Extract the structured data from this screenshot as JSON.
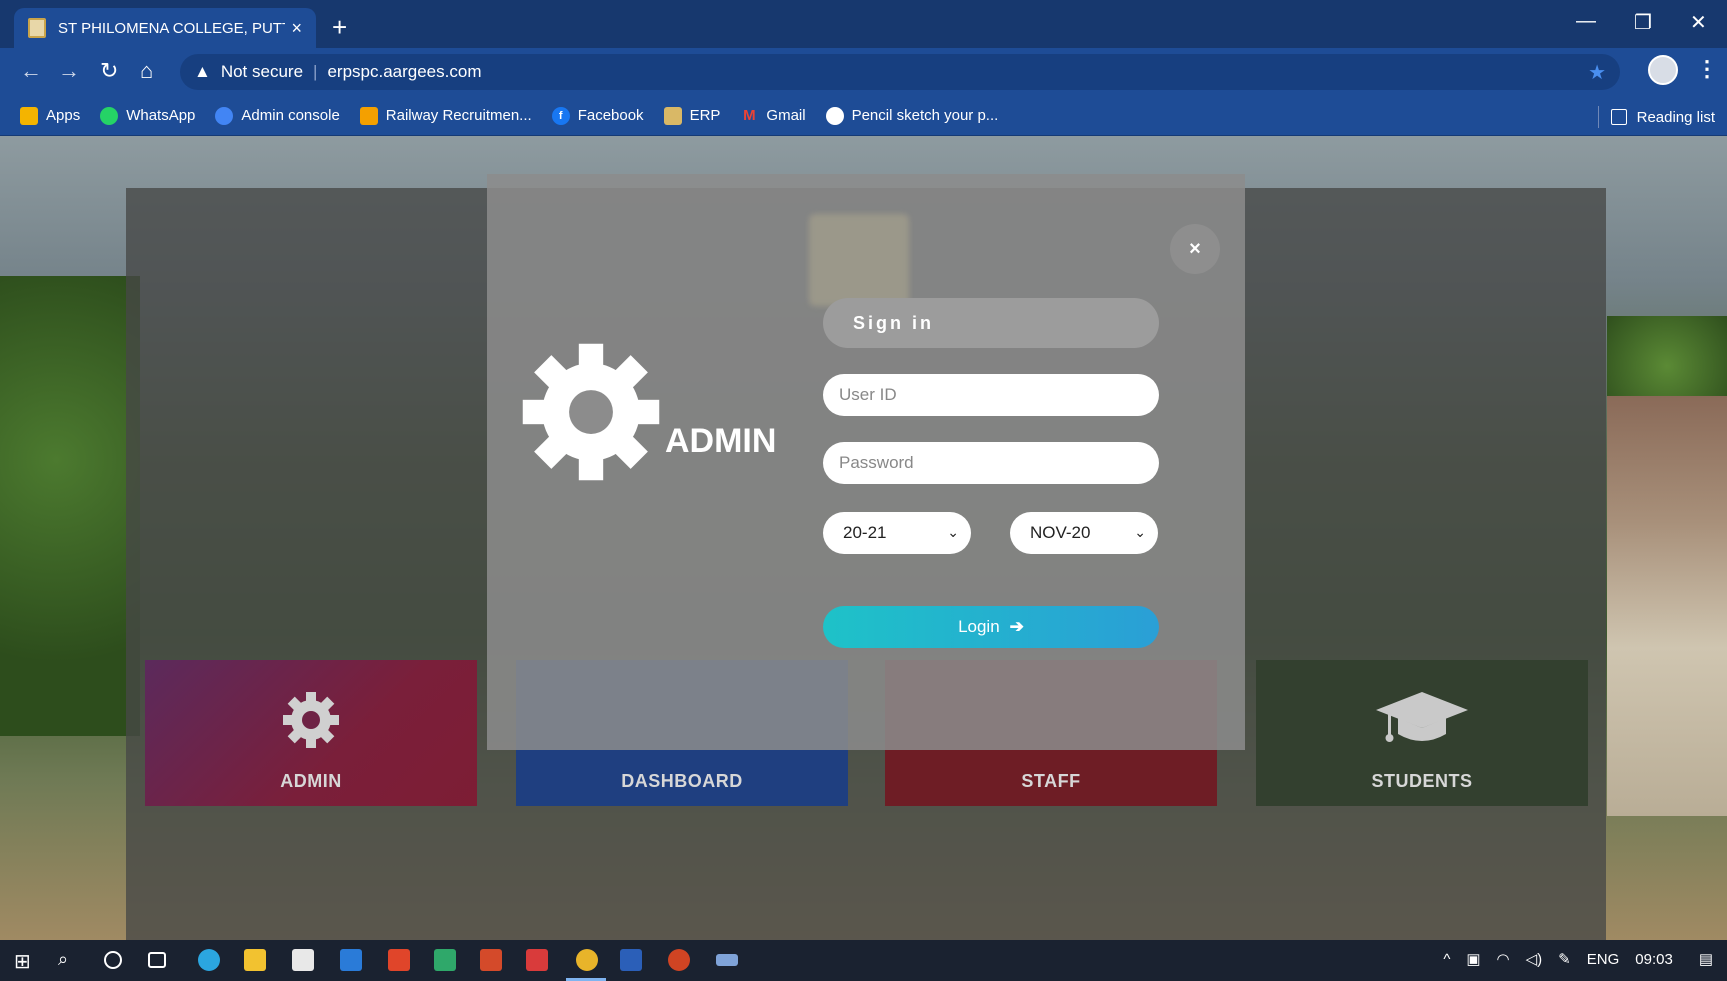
{
  "browser": {
    "tab_title": "ST PHILOMENA COLLEGE, PUTTU",
    "tab_close": "×",
    "new_tab": "+",
    "win_min": "—",
    "win_restore": "❐",
    "win_close": "✕",
    "security": "Not secure",
    "url": "erpspc.aargees.com",
    "reading_list": "Reading list"
  },
  "bookmarks": [
    {
      "label": "Apps",
      "icon": "apps-icon",
      "color": "#f4b400"
    },
    {
      "label": "WhatsApp",
      "icon": "whatsapp-icon",
      "color": "#25d366"
    },
    {
      "label": "Admin console",
      "icon": "admin-console-icon",
      "color": "#4285f4"
    },
    {
      "label": "Railway Recruitmen...",
      "icon": "railway-icon",
      "color": "#f4a000"
    },
    {
      "label": "Facebook",
      "icon": "facebook-icon",
      "color": "#1877f2"
    },
    {
      "label": "ERP",
      "icon": "erp-icon",
      "color": "#d9b866"
    },
    {
      "label": "Gmail",
      "icon": "gmail-icon",
      "color": "#ea4335"
    },
    {
      "label": "Pencil sketch your p...",
      "icon": "globe-icon",
      "color": "#ffffff"
    }
  ],
  "modal": {
    "role_title": "ADMIN",
    "signin_label": "Sign in",
    "userid_placeholder": "User ID",
    "password_placeholder": "Password",
    "year_value": "20-21",
    "month_value": "NOV-20",
    "login_label": "Login",
    "close_glyph": "×"
  },
  "tiles": {
    "admin": "ADMIN",
    "dashboard": "DASHBOARD",
    "staff": "STAFF",
    "students": "STUDENTS"
  },
  "taskbar": {
    "language": "ENG",
    "time": "09:03"
  }
}
